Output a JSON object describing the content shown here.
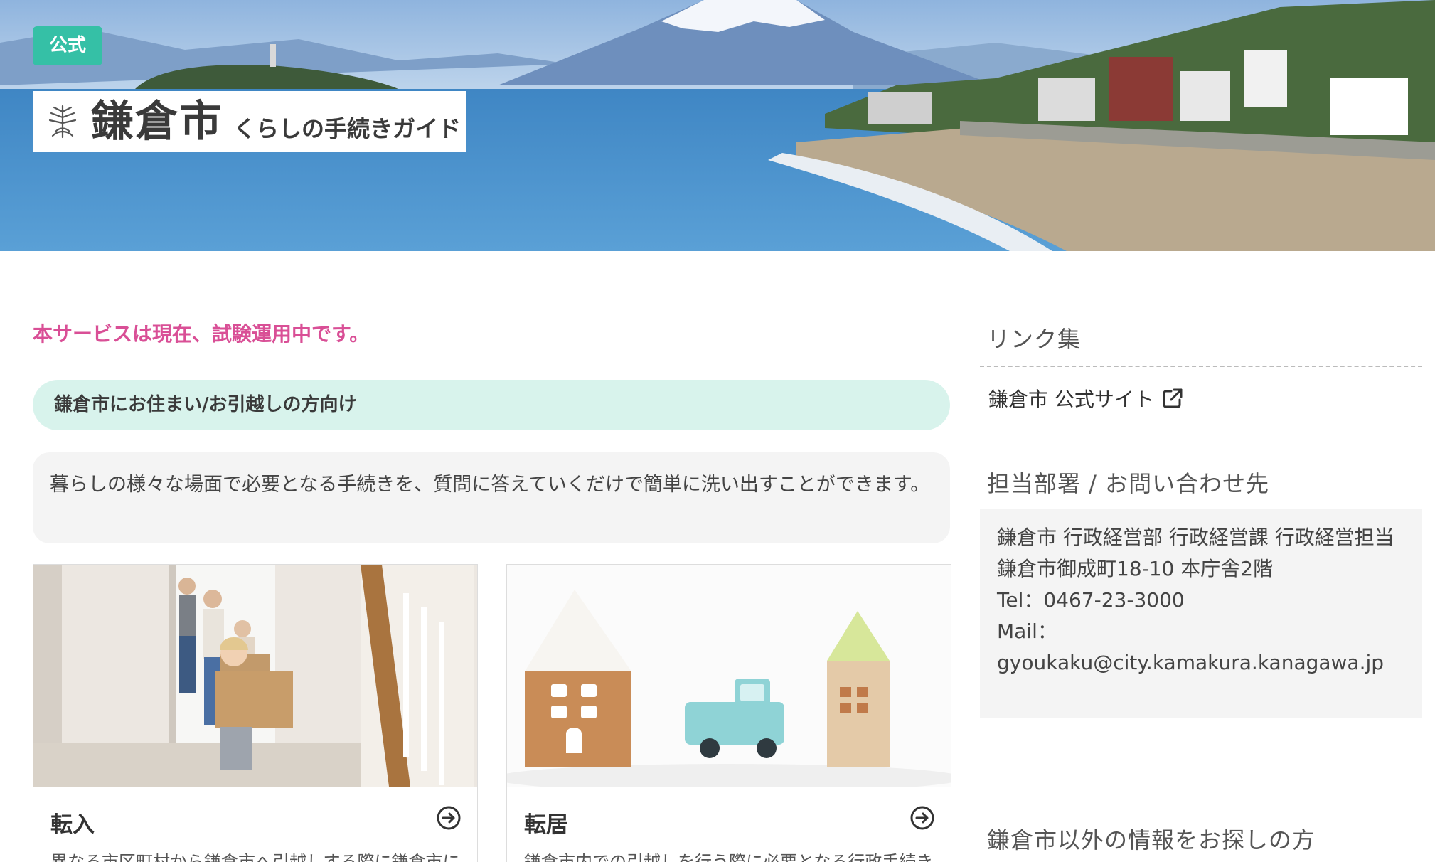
{
  "header": {
    "badge": "公式",
    "city_name": "鎌倉市",
    "guide_name": "くらしの手続きガイド",
    "accent_color": "#35c0a6"
  },
  "main": {
    "notice": "本サービスは現在、試験運用中です。",
    "category": "鎌倉市にお住まい/お引越しの方向け",
    "description": "暮らしの様々な場面で必要となる手続きを、質問に答えていくだけで簡単に洗い出すことができます。",
    "cards": [
      {
        "title": "転入",
        "subtitle": "異なる市区町村から鎌倉市へ引越しする際に鎌倉市に",
        "icon": "arrow-circle-right-icon"
      },
      {
        "title": "転居",
        "subtitle": "鎌倉市内での引越しを行う際に必要となる行政手続き",
        "icon": "arrow-circle-right-icon"
      }
    ]
  },
  "sidebar": {
    "links_heading": "リンク集",
    "official_link": "鎌倉市 公式サイト",
    "contact_heading": "担当部署 / お問い合わせ先",
    "contact": {
      "department": "鎌倉市 行政経営部 行政経営課 行政経営担当",
      "address": "鎌倉市御成町18-10 本庁舎2階",
      "tel": "Tel：0467-23-3000",
      "mail_label": "Mail：",
      "mail": "gyoukaku@city.kamakura.kanagawa.jp"
    },
    "other_heading": "鎌倉市以外の情報をお探しの方"
  }
}
